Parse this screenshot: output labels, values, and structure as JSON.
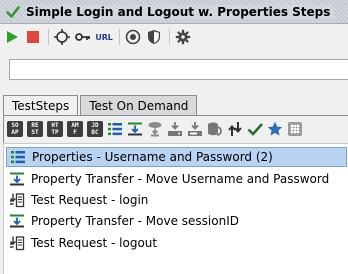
{
  "window": {
    "title": "Simple Login and Logout w. Properties Steps"
  },
  "toolbar": {
    "buttons": [
      {
        "name": "run-icon"
      },
      {
        "name": "stop-icon"
      },
      {
        "name": "options-crosshair-icon"
      },
      {
        "name": "key-icon"
      },
      {
        "name": "url-button",
        "label": "URL"
      },
      {
        "name": "record-icon"
      },
      {
        "name": "shield-icon"
      },
      {
        "name": "gear-icon"
      }
    ]
  },
  "endpoint": {
    "value": ""
  },
  "tabs": [
    {
      "label": "TestSteps",
      "active": true
    },
    {
      "label": "Test On Demand",
      "active": false
    }
  ],
  "steps_toolbar": {
    "icons": [
      "soap-request-icon",
      "rest-request-icon",
      "http-request-icon",
      "amf-request-icon",
      "jdbc-request-icon",
      "properties-step-icon",
      "property-transfer-step-icon",
      "conditional-goto-icon",
      "run-testcase-icon",
      "delay-icon",
      "groovy-script-icon",
      "move-step-icon",
      "assertion-step-icon",
      "mock-response-icon",
      "manual-step-icon"
    ]
  },
  "steps": [
    {
      "label": "Properties - Username and Password (2)",
      "type": "properties",
      "selected": true
    },
    {
      "label": "Property Transfer - Move Username and Password",
      "type": "transfer",
      "selected": false
    },
    {
      "label": "Test Request - login",
      "type": "request",
      "selected": false
    },
    {
      "label": "Property Transfer - Move sessionID",
      "type": "transfer",
      "selected": false
    },
    {
      "label": "Test Request - logout",
      "type": "request",
      "selected": false
    }
  ],
  "colors": {
    "selected_row": "#b8d4f2",
    "run": "#2aa22a",
    "stop": "#e0463c"
  }
}
